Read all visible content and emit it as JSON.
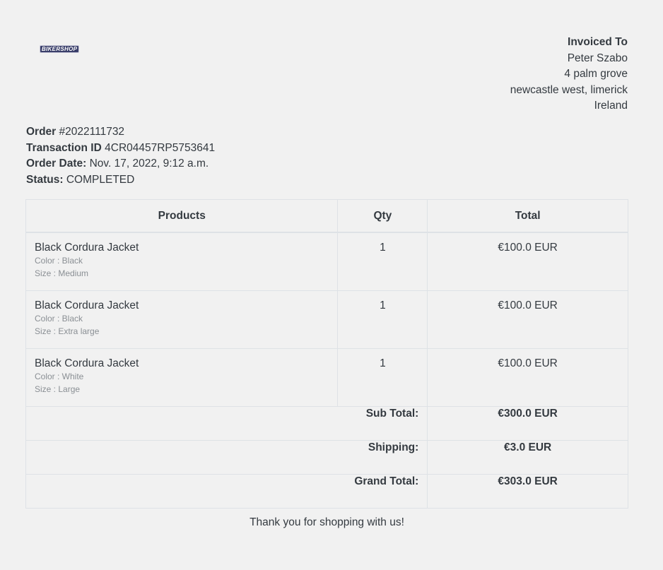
{
  "logo": {
    "text": "BIKERSHOP"
  },
  "invoiced_to": {
    "heading": "Invoiced To",
    "name": "Peter Szabo",
    "address_line1": "4 palm grove",
    "address_line2": "newcastle west, limerick",
    "country": "Ireland"
  },
  "order": {
    "order_label": "Order",
    "order_number": "#2022111732",
    "transaction_label": "Transaction ID",
    "transaction_id": "4CR04457RP5753641",
    "date_label": "Order Date:",
    "date": "Nov. 17, 2022, 9:12 a.m.",
    "status_label": "Status:",
    "status": "COMPLETED"
  },
  "table": {
    "headers": [
      "Products",
      "Qty",
      "Total"
    ],
    "rows": [
      {
        "name": "Black Cordura Jacket",
        "color": "Color : Black",
        "size": "Size : Medium",
        "qty": "1",
        "total": "€100.0 EUR"
      },
      {
        "name": "Black Cordura Jacket",
        "color": "Color : Black",
        "size": "Size : Extra large",
        "qty": "1",
        "total": "€100.0 EUR"
      },
      {
        "name": "Black Cordura Jacket",
        "color": "Color : White",
        "size": "Size : Large",
        "qty": "1",
        "total": "€100.0 EUR"
      }
    ],
    "subtotal_label": "Sub Total:",
    "subtotal": "€300.0 EUR",
    "shipping_label": "Shipping:",
    "shipping": "€3.0 EUR",
    "grand_total_label": "Grand Total:",
    "grand_total": "€303.0 EUR"
  },
  "footer": {
    "thanks": "Thank you for shopping with us!"
  }
}
